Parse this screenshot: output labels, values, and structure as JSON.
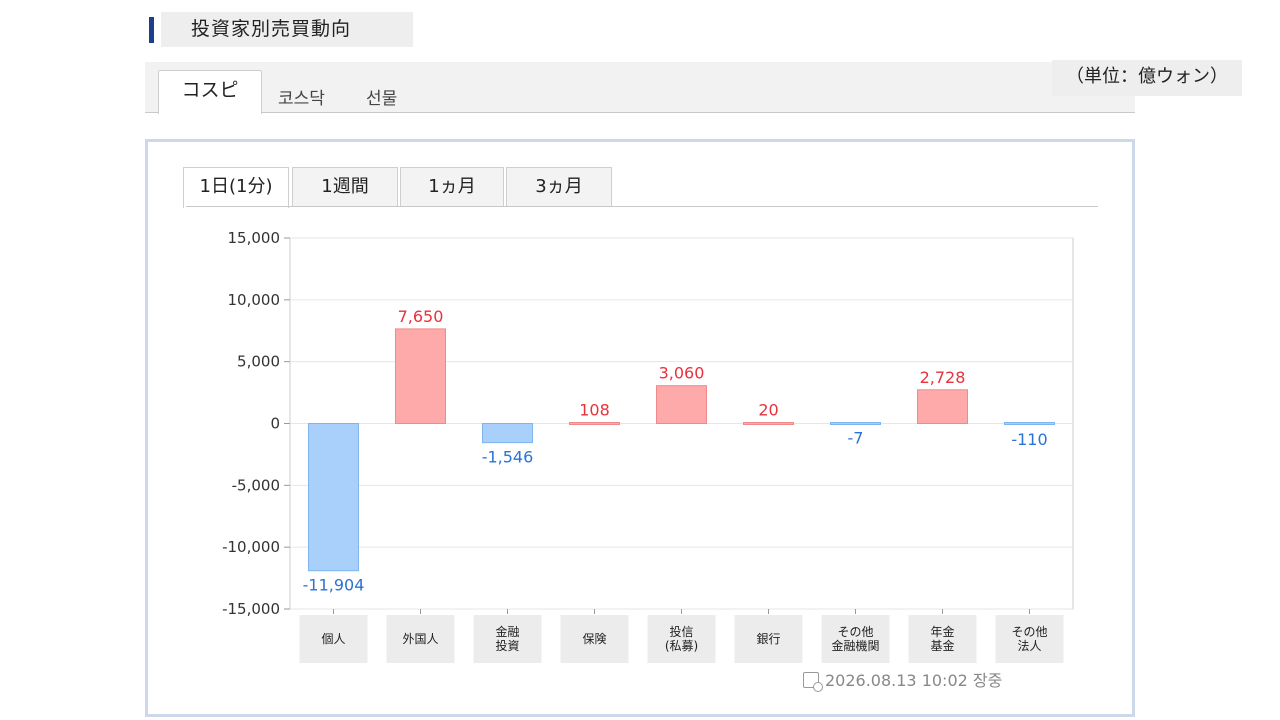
{
  "header": {
    "title": "投資家別売買動向"
  },
  "market_tabs": [
    {
      "label": "コスピ",
      "active": true
    },
    {
      "label": "코스닥",
      "active": false
    },
    {
      "label": "선물",
      "active": false
    }
  ],
  "unit": "（単位：億ウォン）",
  "period_tabs": [
    {
      "label": "1日(1分)",
      "active": true
    },
    {
      "label": "1週間",
      "active": false
    },
    {
      "label": "1ヵ月",
      "active": false
    },
    {
      "label": "3ヵ月",
      "active": false
    }
  ],
  "colors": {
    "positive_bar": "#ffaaaa",
    "negative_bar": "#a9d0fb",
    "positive_text": "#e8323c",
    "negative_text": "#2a73d4"
  },
  "chart_data": {
    "type": "bar",
    "categories": [
      [
        "個人"
      ],
      [
        "外国人"
      ],
      [
        "金融",
        "投資"
      ],
      [
        "保険"
      ],
      [
        "投信",
        "(私募)"
      ],
      [
        "銀行"
      ],
      [
        "その他",
        "金融機関"
      ],
      [
        "年金",
        "基金"
      ],
      [
        "その他",
        "法人"
      ]
    ],
    "values": [
      -11904,
      7650,
      -1546,
      108,
      3060,
      20,
      -7,
      2728,
      -110
    ],
    "value_labels": [
      "-11,904",
      "7,650",
      "-1,546",
      "108",
      "3,060",
      "20",
      "-7",
      "2,728",
      "-110"
    ],
    "ylim": [
      -15000,
      15000
    ],
    "yticks": [
      15000,
      10000,
      5000,
      0,
      -5000,
      -10000,
      -15000
    ],
    "ytick_labels": [
      "15,000",
      "10,000",
      "5,000",
      "0",
      "-5,000",
      "-10,000",
      "-15,000"
    ],
    "grid": true
  },
  "timestamp": "2026.08.13 10:02 장중"
}
